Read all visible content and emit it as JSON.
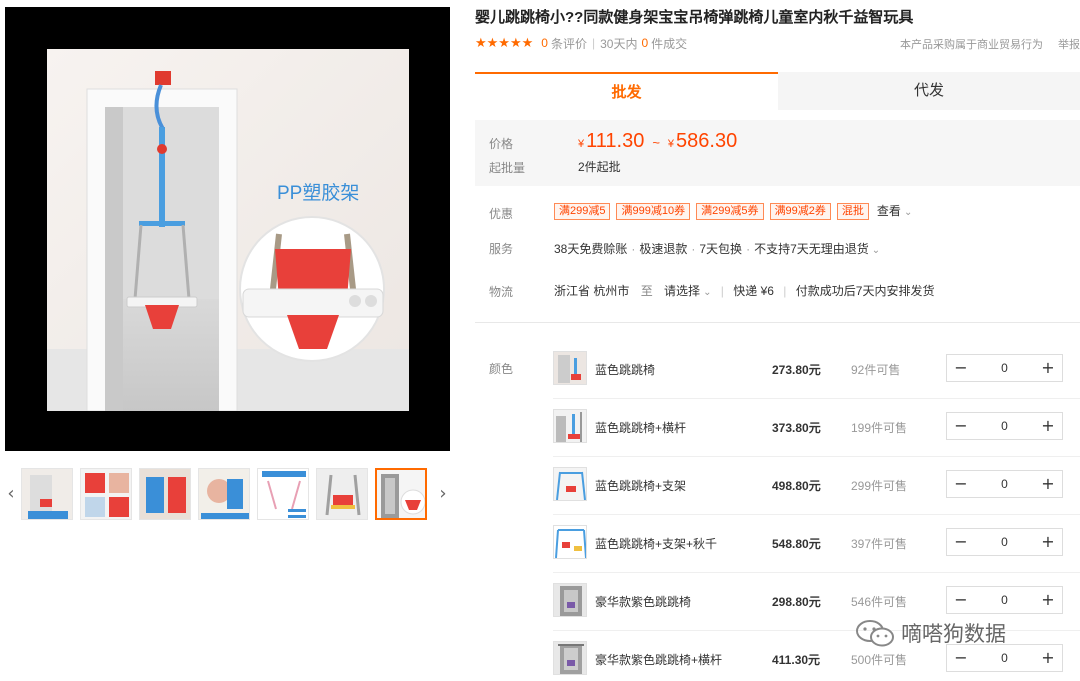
{
  "gallery": {
    "callout_text": "PP塑胶架",
    "thumb_count": 7,
    "active_thumb_index": 6
  },
  "product": {
    "title": "婴儿跳跳椅小??同款健身架宝宝吊椅弹跳椅儿童室内秋千益智玩具",
    "stars": "★★★★★",
    "review_count": "0",
    "review_label": "条评价",
    "sales_prefix": "30天内",
    "sales_count": "0",
    "sales_label": "件成交",
    "notice": "本产品采购属于商业贸易行为",
    "report": "举报"
  },
  "tabs": {
    "wholesale": "批发",
    "dropship": "代发"
  },
  "pricing": {
    "price_label": "价格",
    "currency": "¥",
    "price_min": "111.30",
    "tilde": "~",
    "price_max": "586.30",
    "moq_label": "起批量",
    "moq_value": "2件起批"
  },
  "promo": {
    "label": "优惠",
    "coupons": [
      "满299减5",
      "满999减10券",
      "满299减5券",
      "满99减2券",
      "混批"
    ],
    "see_more": "查看"
  },
  "service": {
    "label": "服务",
    "items": [
      "38天免费赊账",
      "极速退款",
      "7天包换",
      "不支持7天无理由退货"
    ]
  },
  "logistics": {
    "label": "物流",
    "origin": "浙江省 杭州市",
    "to": "至",
    "destination": "请选择",
    "shipping": "快递 ¥6",
    "dispatch": "付款成功后7天内安排发货"
  },
  "variants": {
    "label": "颜色",
    "items": [
      {
        "name": "蓝色跳跳椅",
        "price": "273.80元",
        "stock": "92件可售",
        "qty": "0"
      },
      {
        "name": "蓝色跳跳椅+横杆",
        "price": "373.80元",
        "stock": "199件可售",
        "qty": "0"
      },
      {
        "name": "蓝色跳跳椅+支架",
        "price": "498.80元",
        "stock": "299件可售",
        "qty": "0"
      },
      {
        "name": "蓝色跳跳椅+支架+秋千",
        "price": "548.80元",
        "stock": "397件可售",
        "qty": "0"
      },
      {
        "name": "豪华款紫色跳跳椅",
        "price": "298.80元",
        "stock": "546件可售",
        "qty": "0"
      },
      {
        "name": "豪华款紫色跳跳椅+横杆",
        "price": "411.30元",
        "stock": "500件可售",
        "qty": "0"
      }
    ]
  },
  "watermark": "嘀嗒狗数据",
  "colors": {
    "accent": "#ff6a00",
    "price": "#ff4400"
  }
}
